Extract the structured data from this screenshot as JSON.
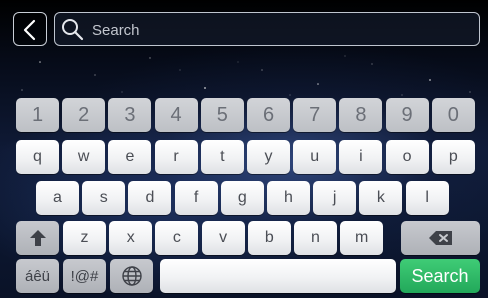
{
  "search": {
    "placeholder": "Search",
    "value": ""
  },
  "top_bar": {
    "back_icon": "chevron-left-icon",
    "search_icon": "magnifier-icon"
  },
  "keyboard": {
    "number_row": [
      "1",
      "2",
      "3",
      "4",
      "5",
      "6",
      "7",
      "8",
      "9",
      "0"
    ],
    "row1": [
      "q",
      "w",
      "e",
      "r",
      "t",
      "y",
      "u",
      "i",
      "o",
      "p"
    ],
    "row2": [
      "a",
      "s",
      "d",
      "f",
      "g",
      "h",
      "j",
      "k",
      "l"
    ],
    "row3": [
      "z",
      "x",
      "c",
      "v",
      "b",
      "n",
      "m"
    ],
    "shift_icon": "shift-arrow-icon",
    "backspace_icon": "backspace-icon",
    "accents_label": "áêü",
    "symbols_label": "!@#",
    "language_icon": "globe-icon",
    "space_label": "",
    "search_key_label": "Search"
  },
  "colors": {
    "accent_green": "#22a85a",
    "key_light": "#f1f2f4",
    "key_gray": "#bdc0c5",
    "background": "#0f1a36"
  }
}
